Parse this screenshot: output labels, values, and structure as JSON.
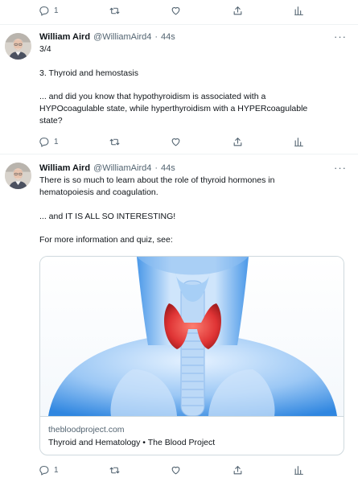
{
  "top_actions": {
    "reply_count": "1"
  },
  "tweet1": {
    "name": "William Aird",
    "handle": "@WilliamAird4",
    "separator": "·",
    "time": "44s",
    "lines": [
      "3/4",
      "3. Thyroid and hemostasis",
      "... and did you know that hypothyroidism is associated with a",
      "HYPOcoagulable state, while hyperthyroidism with a HYPERcoagulable",
      "state?"
    ],
    "reply_count": "1"
  },
  "tweet2": {
    "name": "William Aird",
    "handle": "@WilliamAird4",
    "separator": "·",
    "time": "44s",
    "lines": [
      "There is so much to learn about the role of thyroid hormones in",
      "hematopoiesis and coagulation.",
      "... and IT IS ALL SO INTERESTING!",
      "For more information and quiz, see:"
    ],
    "card": {
      "domain": "thebloodproject.com",
      "title": "Thyroid and Hematology • The Blood Project"
    },
    "reply_count": "1"
  },
  "colors": {
    "text": "#0f1419",
    "secondary": "#536471",
    "border": "#cfd9de",
    "thyroid": "#e02a2a",
    "body_blue": "#3d8fe6"
  },
  "icons": [
    "reply-icon",
    "retweet-icon",
    "like-icon",
    "share-icon",
    "analytics-icon",
    "more-icon"
  ]
}
